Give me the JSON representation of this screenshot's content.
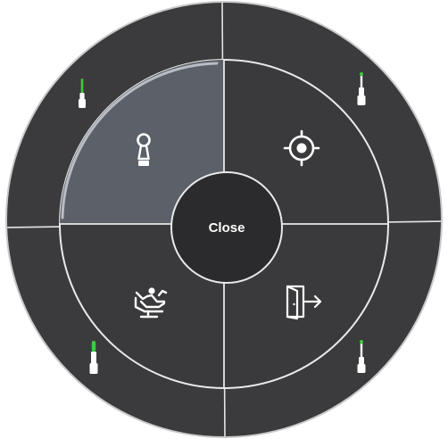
{
  "menu": {
    "close_label": "Close",
    "selected": "keyhole",
    "segments": [
      {
        "id": "keyhole",
        "icon": "keyhole-icon",
        "selected": true
      },
      {
        "id": "target",
        "icon": "crosshair-target-icon",
        "selected": false
      },
      {
        "id": "dental-chair",
        "icon": "dental-chair-icon",
        "selected": false
      },
      {
        "id": "exit",
        "icon": "exit-door-icon",
        "selected": false
      }
    ],
    "instruments": [
      {
        "id": "top-left",
        "icon": "instrument-tool-icon",
        "indicator_color": "#3ecb3e"
      },
      {
        "id": "top-right",
        "icon": "instrument-tool-icon",
        "indicator_color": "#3ecb3e"
      },
      {
        "id": "bottom-left",
        "icon": "instrument-tool-icon",
        "indicator_color": "#3ecb3e"
      },
      {
        "id": "bottom-right",
        "icon": "instrument-tool-icon",
        "indicator_color": "#3ecb3e"
      }
    ]
  },
  "colors": {
    "background": "#ffffff",
    "ring": "#3b3b3d",
    "center": "#2b2b2d",
    "divider": "#e9e9e9",
    "selected": "#5c6068",
    "selected_highlight": "#b8bcc4",
    "indicator": "#3ecb3e",
    "icon": "#ffffff"
  }
}
